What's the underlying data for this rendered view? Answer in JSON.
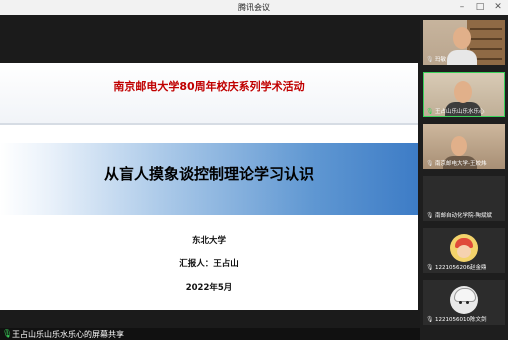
{
  "window": {
    "title": "腾讯会议"
  },
  "slide": {
    "event_title": "南京邮电大学80周年校庆系列学术活动",
    "main_title": "从盲人摸象谈控制理论学习认识",
    "institution": "东北大学",
    "presenter": "汇报人：王占山",
    "date": "2022年5月"
  },
  "share_bar": {
    "text": "王占山乐山乐水乐心的屏幕共享"
  },
  "participants": [
    {
      "name": "玛敏"
    },
    {
      "name": "王占山乐山乐水乐心"
    },
    {
      "name": "南京邮电大学-王姣炜"
    },
    {
      "name": "南邮自动化学院-陶斌斌"
    },
    {
      "name": "1221056206赵金鼎"
    },
    {
      "name": "1221056010陈文剑"
    }
  ],
  "colors": {
    "accent_red": "#c00000",
    "banner_blue": "#3d7cc6",
    "active_green": "#3ad15a"
  }
}
